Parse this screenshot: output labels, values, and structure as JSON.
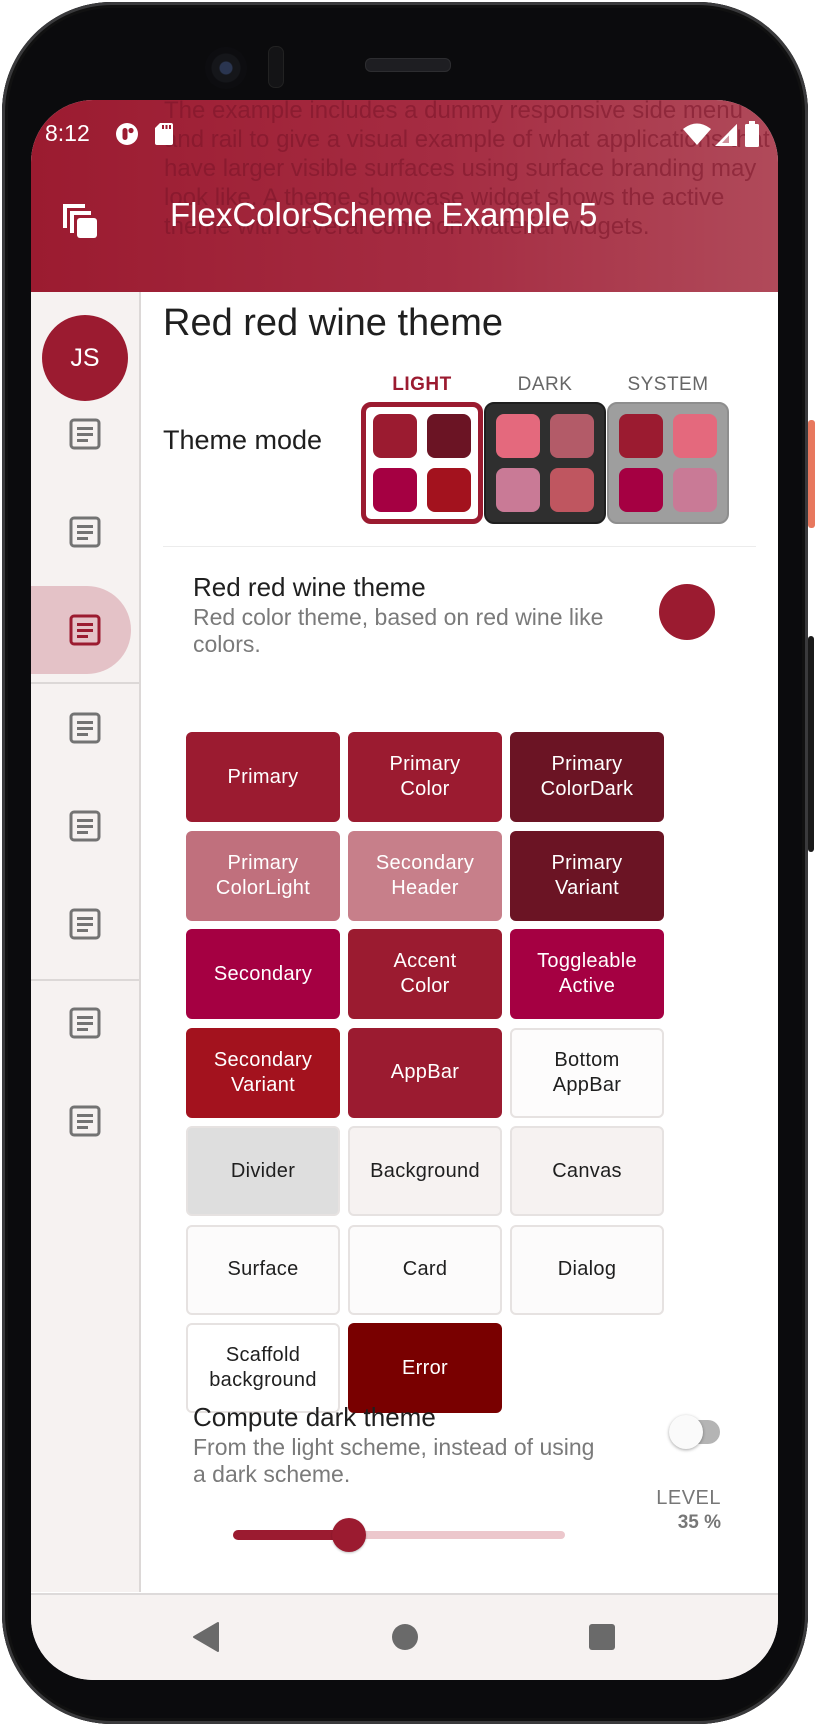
{
  "status_bar": {
    "time": "8:12",
    "left_icons": [
      "data-saver-icon",
      "sd-card-icon"
    ],
    "right_icons": [
      "wifi-icon",
      "cell-signal-icon",
      "battery-icon"
    ]
  },
  "app_bar": {
    "title": "FlexColorScheme Example 5",
    "leading_icon": "copy-layers-icon",
    "behind_text": "The example includes a dummy responsive side menu and rail to give a visual example of what applications that have larger visible surfaces using surface branding may look like. A theme showcase widget shows the active theme with several common Material widgets."
  },
  "rail": {
    "avatar_initials": "JS",
    "items": [
      {
        "icon": "article-icon",
        "selected": false
      },
      {
        "icon": "article-icon",
        "selected": false
      },
      {
        "icon": "article-icon",
        "selected": true
      },
      {
        "icon": "article-icon",
        "selected": false
      },
      {
        "icon": "article-icon",
        "selected": false
      },
      {
        "icon": "article-icon",
        "selected": false
      },
      {
        "icon": "article-icon",
        "selected": false
      },
      {
        "icon": "article-icon",
        "selected": false
      }
    ]
  },
  "main": {
    "page_title": "Red red wine theme",
    "theme_mode": {
      "label": "Theme mode",
      "selected": "LIGHT",
      "options": [
        {
          "label": "LIGHT",
          "swatches": [
            "#9b1b30",
            "#6b1424",
            "#a50042",
            "#a3121e"
          ],
          "box_bg": "#ffffff",
          "border": "#9b1b30"
        },
        {
          "label": "DARK",
          "swatches": [
            "#e4697d",
            "#b35b68",
            "#c97a96",
            "#bf5660"
          ],
          "box_bg": "#2f2f2f",
          "border": "#2f2f2f"
        },
        {
          "label": "SYSTEM",
          "swatches": [
            "#9b1b30",
            "#e4697d",
            "#a50042",
            "#c97a96"
          ],
          "box_bg": "#9e9e9e",
          "border": "#9e9e9e"
        }
      ]
    },
    "scheme": {
      "title": "Red red wine theme",
      "description": "Red color theme, based on red wine like colors.",
      "indicator_color": "#9b1b30"
    },
    "color_cells": [
      {
        "label": "Primary",
        "bg": "#9b1b30",
        "fg": "#ffffff"
      },
      {
        "label": "Primary\nColor",
        "bg": "#9b1b30",
        "fg": "#ffffff"
      },
      {
        "label": "Primary\nColorDark",
        "bg": "#6b1424",
        "fg": "#ffffff"
      },
      {
        "label": "Primary\nColorLight",
        "bg": "#c0707d",
        "fg": "#ffffff"
      },
      {
        "label": "Secondary\nHeader",
        "bg": "#c77f8a",
        "fg": "#ffffff"
      },
      {
        "label": "Primary\nVariant",
        "bg": "#6b1424",
        "fg": "#ffffff"
      },
      {
        "label": "Secondary",
        "bg": "#a50042",
        "fg": "#ffffff"
      },
      {
        "label": "Accent\nColor",
        "bg": "#9b1b30",
        "fg": "#ffffff"
      },
      {
        "label": "Toggleable\nActive",
        "bg": "#a50042",
        "fg": "#ffffff"
      },
      {
        "label": "Secondary\nVariant",
        "bg": "#a3121e",
        "fg": "#ffffff"
      },
      {
        "label": "AppBar",
        "bg": "#9b1b30",
        "fg": "#ffffff"
      },
      {
        "label": "Bottom\nAppBar",
        "bg": "#fdfcfc",
        "fg": "#1f1f1f"
      },
      {
        "label": "Divider",
        "bg": "#dedede",
        "fg": "#1f1f1f"
      },
      {
        "label": "Background",
        "bg": "#f6f2f1",
        "fg": "#1f1f1f"
      },
      {
        "label": "Canvas",
        "bg": "#f6f2f1",
        "fg": "#1f1f1f"
      },
      {
        "label": "Surface",
        "bg": "#fcfbfb",
        "fg": "#1f1f1f"
      },
      {
        "label": "Card",
        "bg": "#fcfbfb",
        "fg": "#1f1f1f"
      },
      {
        "label": "Dialog",
        "bg": "#fcfbfb",
        "fg": "#1f1f1f"
      },
      {
        "label": "Scaffold\nbackground",
        "bg": "#ffffff",
        "fg": "#1f1f1f"
      },
      {
        "label": "Error",
        "bg": "#790000",
        "fg": "#ffffff"
      }
    ],
    "compute_dark": {
      "title": "Compute dark theme",
      "description": "From the light scheme, instead of using a dark scheme.",
      "enabled": false
    },
    "level": {
      "label": "LEVEL",
      "value_text": "35 %",
      "value": 35
    }
  },
  "system_nav": {
    "buttons": [
      "back-icon",
      "home-icon",
      "recents-icon"
    ]
  },
  "colors": {
    "primary": "#9b1b30",
    "rail_bg": "#f6f2f1",
    "slider_inactive": "#ecc7cc"
  }
}
